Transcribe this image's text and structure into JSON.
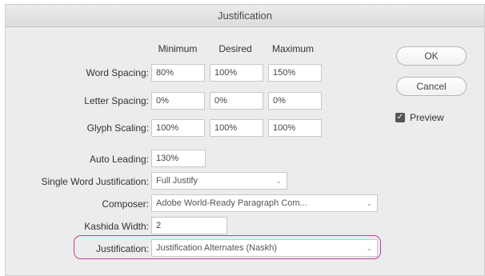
{
  "window": {
    "title": "Justification"
  },
  "spacing": {
    "headers": [
      "Minimum",
      "Desired",
      "Maximum"
    ],
    "rows": [
      {
        "label": "Word Spacing:",
        "minimum": "80%",
        "desired": "100%",
        "maximum": "150%"
      },
      {
        "label": "Letter Spacing:",
        "minimum": "0%",
        "desired": "0%",
        "maximum": "0%"
      },
      {
        "label": "Glyph Scaling:",
        "minimum": "100%",
        "desired": "100%",
        "maximum": "100%"
      }
    ]
  },
  "auto_leading": {
    "label": "Auto Leading:",
    "value": "130%"
  },
  "single_word": {
    "label": "Single Word Justification:",
    "value": "Full Justify"
  },
  "composer": {
    "label": "Composer:",
    "value": "Adobe World-Ready Paragraph Com..."
  },
  "kashida": {
    "label": "Kashida Width:",
    "value": "2"
  },
  "justification": {
    "label": "Justification:",
    "value": "Justification Alternates (Naskh)"
  },
  "buttons": {
    "ok": "OK",
    "cancel": "Cancel"
  },
  "preview": {
    "label": "Preview",
    "checked": true
  },
  "icons": {
    "dropdown": "chevron-down-icon",
    "checkbox": "checkmark-icon"
  },
  "colors": {
    "highlight": "#c53f9a"
  }
}
